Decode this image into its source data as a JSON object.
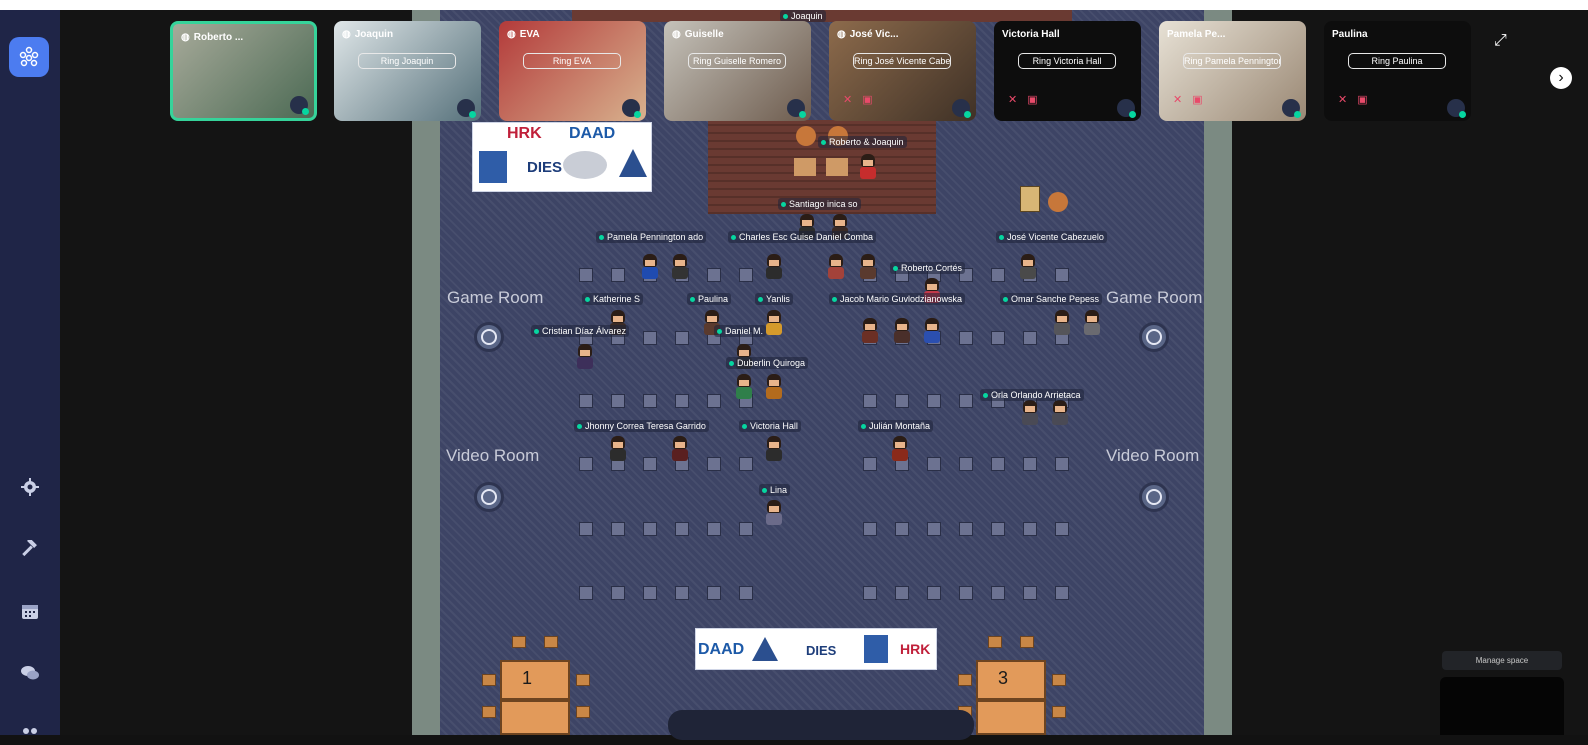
{
  "app": {
    "manage_space": "Manage space"
  },
  "tiles": [
    {
      "name": "Roberto ...",
      "ring": "",
      "video": true,
      "active": true,
      "muted": false
    },
    {
      "name": "Joaquin",
      "ring": "Ring Joaquin",
      "video": true,
      "active": false,
      "muted": false
    },
    {
      "name": "EVA",
      "ring": "Ring EVA",
      "video": true,
      "active": false,
      "muted": false
    },
    {
      "name": "Guiselle",
      "ring": "Ring Guiselle Romero",
      "video": true,
      "active": false,
      "muted": false
    },
    {
      "name": "José Vic...",
      "ring": "Ring José Vicente Cabez",
      "video": true,
      "active": false,
      "muted": false
    },
    {
      "name": "Victoria Hall",
      "ring": "Ring Victoria Hall",
      "video": false,
      "active": false,
      "muted": true
    },
    {
      "name": "Pamela Pe...",
      "ring": "Ring Pamela Pennington",
      "video": true,
      "active": false,
      "muted": true
    },
    {
      "name": "Paulina",
      "ring": "Ring Paulina",
      "video": false,
      "active": false,
      "muted": true
    }
  ],
  "map": {
    "rooms": {
      "game_room": "Game Room",
      "video_room": "Video Room"
    },
    "banner_top": {
      "hrk": "HRK",
      "daad": "DAAD",
      "dies": "DIES"
    },
    "banner_bottom": {
      "daad": "DAAD",
      "dies": "DIES",
      "hrk": "HRK"
    },
    "tables": {
      "t1": "1",
      "t3": "3"
    },
    "names": {
      "joaquin": "Joaquin",
      "roberto_joaquin": "Roberto & Joaquin",
      "santiago": "Santiago inica so",
      "pamela": "Pamela Pennington ado",
      "charles": "Charles Esc Guise Daniel Comba",
      "jose_vicente": "José Vicente Cabezuelo",
      "roberto_cortes": "Roberto Cortés",
      "katherine": "Katherine S",
      "paulina": "Paulina",
      "yanlis": "Yanlis",
      "jacob": "Jacob Mario Guvlodzianowska",
      "omar": "Omar Sanche Pepess",
      "cristian": "Cristian Díaz Álvarez",
      "daniel_m": "Daniel M.",
      "duberlin": "Duberlin Quiroga",
      "orlando": "Orla Orlando Arrietaca",
      "jhonny": "Jhonny Correa Teresa Garrido",
      "victoria": "Victoria Hall",
      "julian": "Julián Montaña",
      "lina": "Lina"
    }
  },
  "colors": {
    "accent": "#4c7cf0",
    "online": "#06d6a0",
    "floor": "#3d4465",
    "rail": "#1f2547"
  }
}
